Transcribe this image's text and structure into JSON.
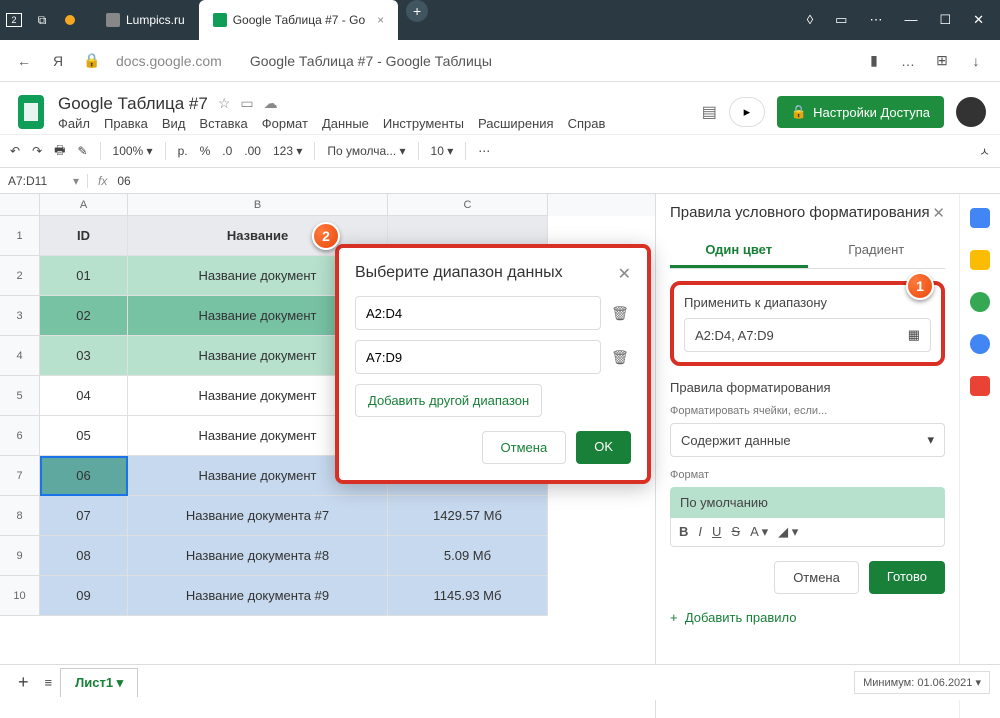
{
  "titlebar": {
    "tab1": "Lumpics.ru",
    "tab2": "Google Таблица #7 - Go",
    "home_badge": "2"
  },
  "addr": {
    "url": "docs.google.com",
    "title": "Google Таблица #7 - Google Таблицы"
  },
  "doc": {
    "title": "Google Таблица #7",
    "menu": [
      "Файл",
      "Правка",
      "Вид",
      "Вставка",
      "Формат",
      "Данные",
      "Инструменты",
      "Расширения",
      "Справ"
    ]
  },
  "share": "Настройки Доступа",
  "toolbar": {
    "zoom": "100%",
    "curr": "р.",
    "pct": "%",
    "dec1": ".0",
    "dec2": ".00",
    "num": "123",
    "font": "По умолча...",
    "size": "10"
  },
  "formula": {
    "ref": "A7:D11",
    "fx": "fx",
    "val": "06"
  },
  "cols": [
    "A",
    "B",
    "C"
  ],
  "table": {
    "head": [
      "ID",
      "Название",
      ""
    ],
    "rows": [
      {
        "n": "1",
        "a": "ID",
        "b": "Название",
        "c": "",
        "cls": "hdr"
      },
      {
        "n": "2",
        "a": "01",
        "b": "Название документ",
        "c": "",
        "cls": "green"
      },
      {
        "n": "3",
        "a": "02",
        "b": "Название документ",
        "c": "",
        "cls": "dgreen"
      },
      {
        "n": "4",
        "a": "03",
        "b": "Название документ",
        "c": "",
        "cls": "green"
      },
      {
        "n": "5",
        "a": "04",
        "b": "Название документ",
        "c": "",
        "cls": ""
      },
      {
        "n": "6",
        "a": "05",
        "b": "Название документ",
        "c": "",
        "cls": ""
      },
      {
        "n": "7",
        "a": "06",
        "b": "Название документ",
        "c": "",
        "cls": "blue",
        "sel": true
      },
      {
        "n": "8",
        "a": "07",
        "b": "Название документа #7",
        "c": "1429.57 Мб",
        "cls": "blue"
      },
      {
        "n": "9",
        "a": "08",
        "b": "Название документа #8",
        "c": "5.09 Мб",
        "cls": "blue"
      },
      {
        "n": "10",
        "a": "09",
        "b": "Название документа #9",
        "c": "1145.93 Мб",
        "cls": "blue"
      }
    ]
  },
  "dialog": {
    "title": "Выберите диапазон данных",
    "r1": "A2:D4",
    "r2": "A7:D9",
    "add": "Добавить другой диапазон",
    "cancel": "Отмена",
    "ok": "OK"
  },
  "panel": {
    "title": "Правила условного форматирования",
    "tab1": "Один цвет",
    "tab2": "Градиент",
    "applyto": "Применить к диапазону",
    "range": "A2:D4, A7:D9",
    "rules": "Правила форматирования",
    "if": "Форматировать ячейки, если...",
    "cond": "Содержит данные",
    "format": "Формат",
    "preview": "По умолчанию",
    "cancel": "Отмена",
    "done": "Готово",
    "addrule": "Добавить правило"
  },
  "bottom": {
    "sheet": "Лист1",
    "date": "Минимум: 01.06.2021"
  }
}
